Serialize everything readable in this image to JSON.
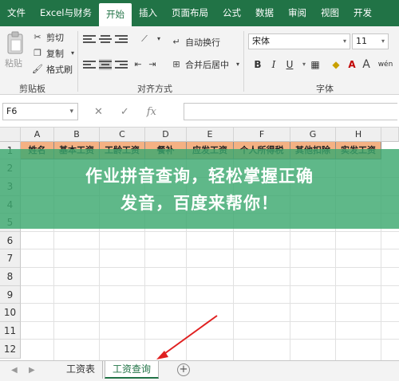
{
  "ribbon_tabs": [
    "文件",
    "Excel与财务",
    "开始",
    "插入",
    "页面布局",
    "公式",
    "数据",
    "审阅",
    "视图",
    "开发"
  ],
  "active_tab": "开始",
  "clipboard": {
    "paste": "粘贴",
    "cut": "剪切",
    "copy": "复制",
    "format_painter": "格式刷",
    "group": "剪贴板"
  },
  "alignment": {
    "wrap_text": "自动换行",
    "merge_center": "合并后居中",
    "group": "对齐方式"
  },
  "font": {
    "name": "宋体",
    "size": "11",
    "bold": "B",
    "italic": "I",
    "underline": "U",
    "grow": "A",
    "shrink": "A",
    "wen": "wén",
    "group": "字体"
  },
  "formula_bar": {
    "name_box": "F6",
    "cancel": "✕",
    "enter": "✓",
    "fx": "fx",
    "content": ""
  },
  "columns": [
    "A",
    "B",
    "C",
    "D",
    "E",
    "F",
    "G",
    "H"
  ],
  "rows": [
    "1",
    "2",
    "3",
    "4",
    "5",
    "6",
    "7",
    "8",
    "9",
    "10",
    "11",
    "12"
  ],
  "header_row": [
    "姓名",
    "基本工资",
    "工龄工资",
    "餐补",
    "应发工资",
    "个人所得税",
    "其他扣除",
    "实发工资"
  ],
  "banner": {
    "line1": "作业拼音查询，轻松掌握正确",
    "line2": "发音，百度来帮你！"
  },
  "sheets": [
    "工资表",
    "工资查询"
  ],
  "active_sheet": "工资查询",
  "colors": {
    "ribbon_green": "#217346",
    "header_fill": "#f4b183",
    "banner_green": "#3ca86f",
    "arrow_red": "#e02020"
  }
}
